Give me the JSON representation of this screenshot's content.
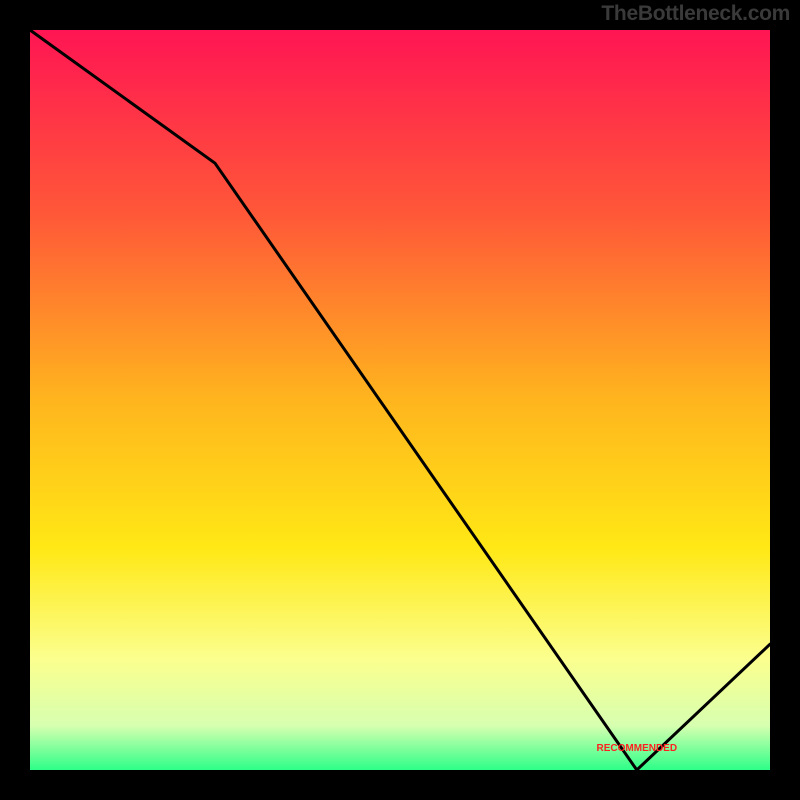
{
  "watermark": "TheBottleneck.com",
  "annotation_label": "RECOMMENDED",
  "chart_data": {
    "type": "line",
    "title": "",
    "xlabel": "",
    "ylabel": "",
    "xlim": [
      0,
      100
    ],
    "ylim": [
      0,
      100
    ],
    "x": [
      0,
      25,
      82,
      100
    ],
    "values": [
      100,
      82,
      0,
      17
    ],
    "annotation": {
      "x": 82,
      "y": 2,
      "text": "RECOMMENDED"
    },
    "gradient_stops": [
      {
        "pct": 0,
        "color": "#ff1553"
      },
      {
        "pct": 25,
        "color": "#ff5838"
      },
      {
        "pct": 50,
        "color": "#ffb51e"
      },
      {
        "pct": 70,
        "color": "#ffe815"
      },
      {
        "pct": 85,
        "color": "#fbff8e"
      },
      {
        "pct": 94,
        "color": "#d7ffb0"
      },
      {
        "pct": 100,
        "color": "#2dff88"
      }
    ]
  }
}
